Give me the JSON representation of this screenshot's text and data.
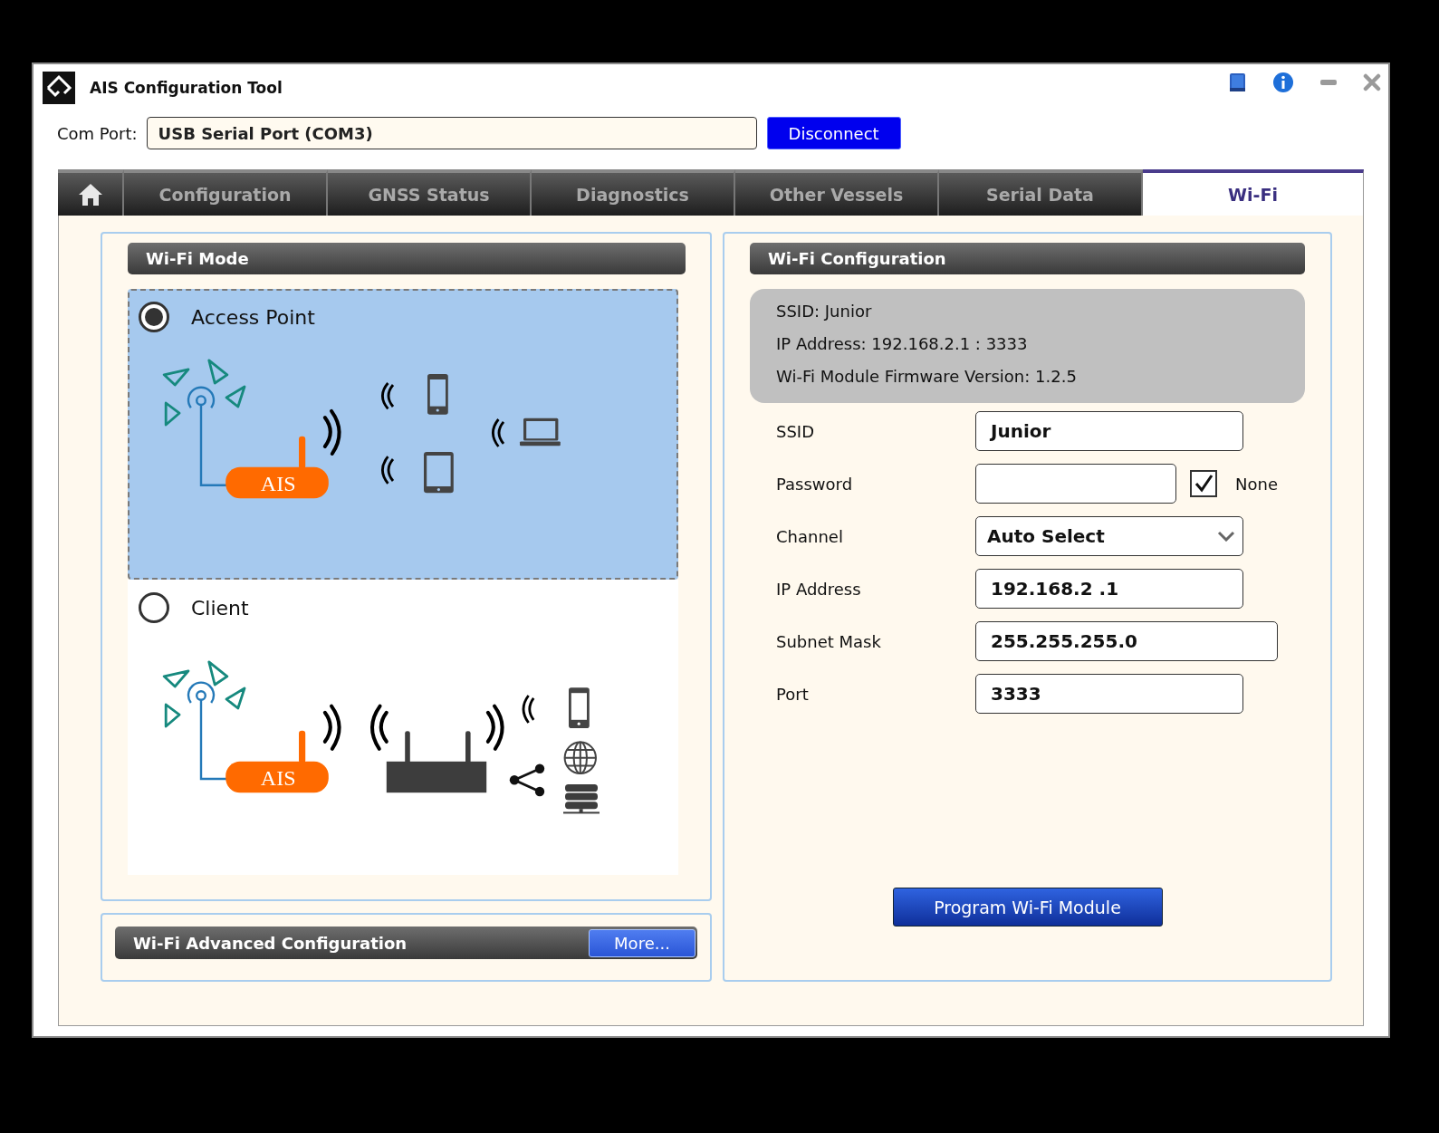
{
  "window": {
    "title": "AIS Configuration Tool"
  },
  "com_port": {
    "label": "Com Port:",
    "value": "USB Serial Port (COM3)"
  },
  "disconnect_button": "Disconnect",
  "tabs": [
    {
      "kind": "home",
      "selected": false
    },
    {
      "kind": "text",
      "label": "Configuration",
      "selected": false
    },
    {
      "kind": "text",
      "label": "GNSS Status",
      "selected": false
    },
    {
      "kind": "text",
      "label": "Diagnostics",
      "selected": false
    },
    {
      "kind": "text",
      "label": "Other Vessels",
      "selected": false
    },
    {
      "kind": "text",
      "label": "Serial Data",
      "selected": false
    },
    {
      "kind": "text",
      "label": "Wi-Fi",
      "selected": true
    }
  ],
  "wifi_mode": {
    "title": "Wi-Fi Mode",
    "options": [
      {
        "kind": "access_point",
        "label": "Access Point",
        "device_label": "AIS",
        "selected": true
      },
      {
        "kind": "client",
        "label": "Client",
        "device_label": "AIS",
        "selected": false
      }
    ]
  },
  "advanced": {
    "title": "Wi-Fi Advanced Configuration",
    "button": "More..."
  },
  "wifi_configuration": {
    "title": "Wi-Fi Configuration",
    "info": [
      "SSID: Junior",
      "IP Address: 192.168.2.1 : 3333",
      "Wi-Fi Module Firmware Version: 1.2.5"
    ],
    "fields": [
      {
        "kind": "text",
        "label": "SSID",
        "value": "Junior"
      },
      {
        "kind": "password",
        "label": "Password",
        "option": {
          "label": "None",
          "checked": true
        }
      },
      {
        "kind": "select",
        "label": "Channel",
        "value": "Auto Select"
      },
      {
        "kind": "text",
        "label": "IP Address",
        "value": "192.168.2 .1"
      },
      {
        "kind": "wide_text",
        "label": "Subnet Mask",
        "value": "255.255.255.0"
      },
      {
        "kind": "text",
        "label": "Port",
        "value": "3333"
      }
    ],
    "program_button": "Program Wi-Fi Module"
  }
}
